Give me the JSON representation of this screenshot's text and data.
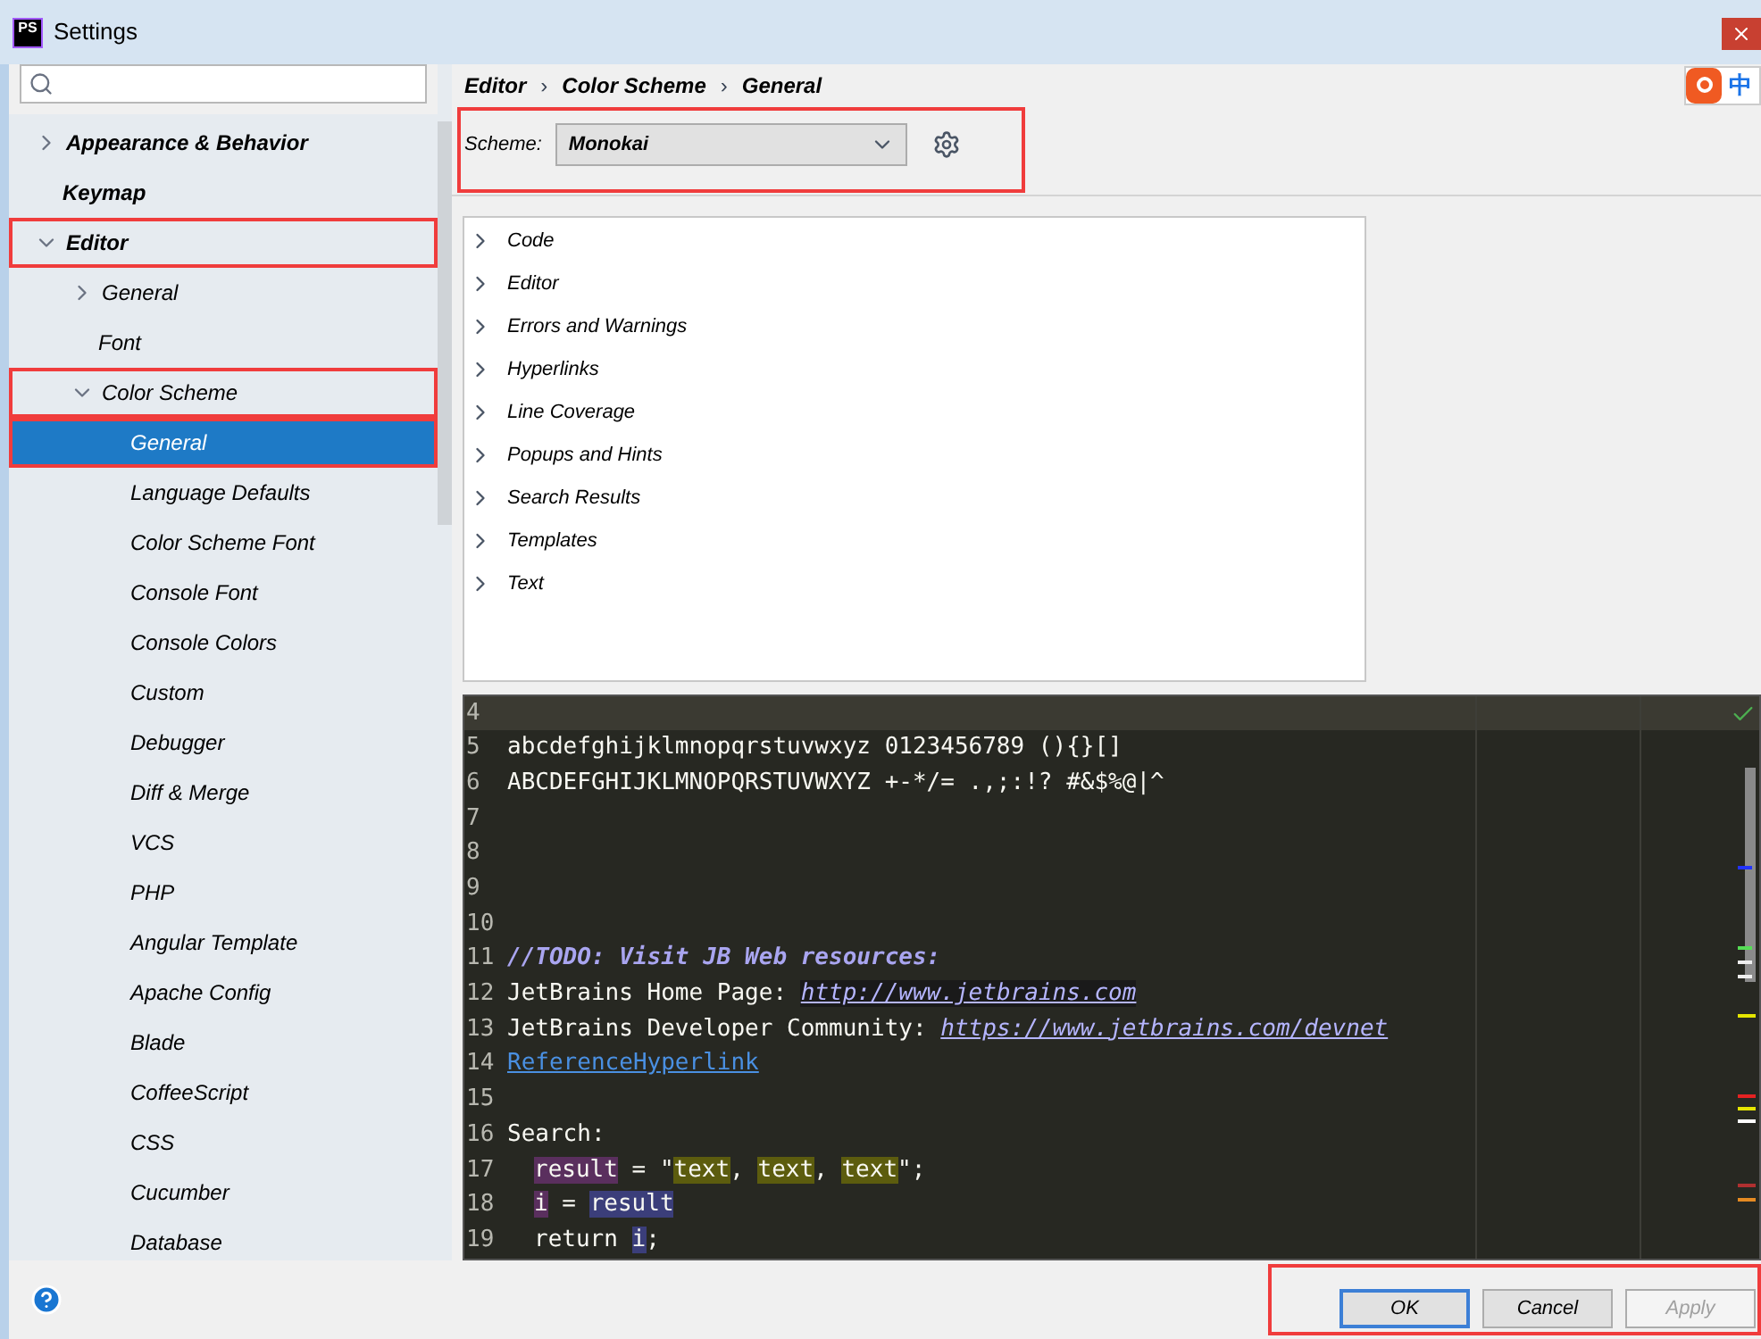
{
  "window": {
    "title": "Settings",
    "logo": "PS"
  },
  "ime": {
    "label": "中"
  },
  "sidebar": {
    "items": [
      {
        "label": "Appearance & Behavior",
        "expanded": false,
        "selected": false
      },
      {
        "label": "Keymap",
        "selected": false
      },
      {
        "label": "Editor",
        "expanded": true,
        "selected": false,
        "children": [
          {
            "label": "General",
            "expanded": false,
            "selected": false
          },
          {
            "label": "Font",
            "selected": false
          },
          {
            "label": "Color Scheme",
            "expanded": true,
            "selected": false,
            "children": [
              {
                "label": "General",
                "selected": true
              },
              {
                "label": "Language Defaults",
                "selected": false
              },
              {
                "label": "Color Scheme Font",
                "selected": false
              },
              {
                "label": "Console Font",
                "selected": false
              },
              {
                "label": "Console Colors",
                "selected": false
              },
              {
                "label": "Custom",
                "selected": false
              },
              {
                "label": "Debugger",
                "selected": false
              },
              {
                "label": "Diff & Merge",
                "selected": false
              },
              {
                "label": "VCS",
                "selected": false
              },
              {
                "label": "PHP",
                "selected": false
              },
              {
                "label": "Angular Template",
                "selected": false
              },
              {
                "label": "Apache Config",
                "selected": false
              },
              {
                "label": "Blade",
                "selected": false
              },
              {
                "label": "CoffeeScript",
                "selected": false
              },
              {
                "label": "CSS",
                "selected": false
              },
              {
                "label": "Cucumber",
                "selected": false
              },
              {
                "label": "Database",
                "selected": false
              }
            ]
          }
        ]
      }
    ]
  },
  "breadcrumb": [
    "Editor",
    "Color Scheme",
    "General"
  ],
  "breadcrumb_separator": "›",
  "scheme": {
    "label": "Scheme:",
    "value": "Monokai"
  },
  "categories": [
    {
      "label": "Code",
      "expanded": false
    },
    {
      "label": "Editor",
      "expanded": false
    },
    {
      "label": "Errors and Warnings",
      "expanded": false
    },
    {
      "label": "Hyperlinks",
      "expanded": false
    },
    {
      "label": "Line Coverage",
      "expanded": false
    },
    {
      "label": "Popups and Hints",
      "expanded": false
    },
    {
      "label": "Search Results",
      "expanded": false
    },
    {
      "label": "Templates",
      "expanded": false
    },
    {
      "label": "Text",
      "expanded": false
    }
  ],
  "preview": {
    "lines": [
      {
        "number": "4",
        "current": true
      },
      {
        "number": "5",
        "current": false,
        "segments": [
          {
            "kind": "plain",
            "text": "abcdefghijklmnopqrstuvwxyz 0123456789 (){}[]"
          }
        ]
      },
      {
        "number": "6",
        "current": false,
        "segments": [
          {
            "kind": "plain",
            "text": "ABCDEFGHIJKLMNOPQRSTUVWXYZ +-*/= .,;:!? #&$%@|^"
          }
        ]
      },
      {
        "number": "7",
        "current": false
      },
      {
        "number": "8",
        "current": false
      },
      {
        "number": "9",
        "current": false
      },
      {
        "number": "10",
        "current": false
      },
      {
        "number": "11",
        "current": false,
        "segments": [
          {
            "kind": "todo",
            "text": "//TODO: Visit JB Web resources:"
          }
        ]
      },
      {
        "number": "12",
        "current": false,
        "segments": [
          {
            "kind": "plain",
            "text": "JetBrains Home Page: "
          },
          {
            "kind": "link_focused",
            "text": "http://www.jetbrains.com"
          }
        ]
      },
      {
        "number": "13",
        "current": false,
        "segments": [
          {
            "kind": "plain",
            "text": "JetBrains Developer Community: "
          },
          {
            "kind": "link",
            "text": "https://www.jetbrains.com/devnet"
          }
        ]
      },
      {
        "number": "14",
        "current": false,
        "segments": [
          {
            "kind": "reference",
            "text": "ReferenceHyperlink"
          }
        ]
      },
      {
        "number": "15",
        "current": false
      },
      {
        "number": "16",
        "current": false,
        "segments": [
          {
            "kind": "plain",
            "text": "Search:"
          }
        ]
      },
      {
        "number": "17",
        "current": false,
        "indented": true,
        "segments": [
          {
            "kind": "write_usage",
            "text": "result"
          },
          {
            "kind": "plain",
            "text": " = \""
          },
          {
            "kind": "search_result",
            "text": "text"
          },
          {
            "kind": "plain",
            "text": ", "
          },
          {
            "kind": "search_result",
            "text": "text"
          },
          {
            "kind": "plain",
            "text": ", "
          },
          {
            "kind": "search_result",
            "text": "text"
          },
          {
            "kind": "plain",
            "text": "\";"
          }
        ]
      },
      {
        "number": "18",
        "current": false,
        "indented": true,
        "segments": [
          {
            "kind": "write_usage",
            "text": "i"
          },
          {
            "kind": "plain",
            "text": " = "
          },
          {
            "kind": "read_usage",
            "text": "result"
          }
        ]
      },
      {
        "number": "19",
        "current": false,
        "indented": true,
        "segments": [
          {
            "kind": "plain",
            "text": "return "
          },
          {
            "kind": "read_usage",
            "text": "i"
          },
          {
            "kind": "plain",
            "text": ";"
          }
        ]
      }
    ]
  },
  "buttons": [
    {
      "label": "OK",
      "kind": "default",
      "disabled": false
    },
    {
      "label": "Cancel",
      "kind": "normal",
      "disabled": false
    },
    {
      "label": "Apply",
      "kind": "normal",
      "disabled": true
    }
  ]
}
